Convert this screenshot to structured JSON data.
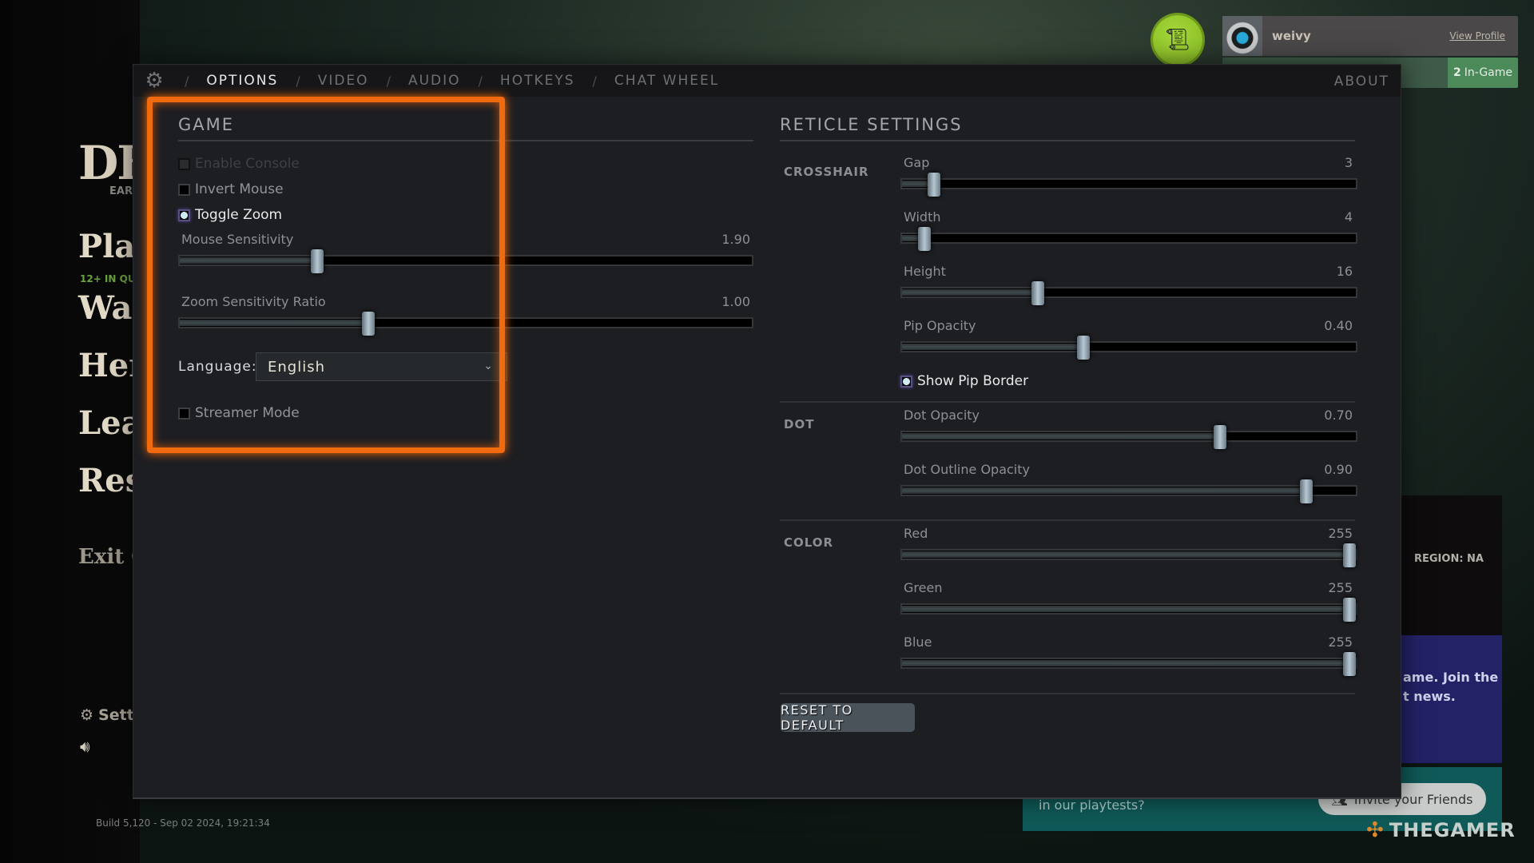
{
  "background": {
    "logo": "DE",
    "logo_sub": "EAR",
    "menu": [
      {
        "label": "Play"
      },
      {
        "label": "Wat"
      },
      {
        "label": "Her"
      },
      {
        "label": "Lear"
      },
      {
        "label": "Res"
      },
      {
        "label": "Exit G"
      }
    ],
    "queue_badge": "12+ IN QU",
    "settings_label": "Sett",
    "build": "Build 5,120 - Sep 02 2024, 19:21:34",
    "profile": {
      "name": "weivy",
      "view_profile": "View Profile"
    },
    "friends": {
      "count": "2",
      "label": "In-Game"
    },
    "region": "REGION: NA",
    "promo_text": [
      "ame. Join the",
      "t news."
    ],
    "playtest_text": "in our playtests?",
    "invite_label": "Invite your Friends",
    "watermark": "THEGAMER"
  },
  "tabs": {
    "items": [
      {
        "label": "OPTIONS",
        "active": true
      },
      {
        "label": "VIDEO",
        "active": false
      },
      {
        "label": "AUDIO",
        "active": false
      },
      {
        "label": "HOTKEYS",
        "active": false
      },
      {
        "label": "CHAT WHEEL",
        "active": false
      }
    ],
    "about": "ABOUT"
  },
  "game": {
    "title": "GAME",
    "checkboxes": [
      {
        "label": "Enable Console",
        "checked": false,
        "disabled": true
      },
      {
        "label": "Invert Mouse",
        "checked": false,
        "disabled": false
      },
      {
        "label": "Toggle Zoom",
        "checked": true,
        "disabled": false
      }
    ],
    "sliders": [
      {
        "label": "Mouse Sensitivity",
        "value": "1.90",
        "fraction": 0.24
      },
      {
        "label": "Zoom Sensitivity Ratio",
        "value": "1.00",
        "fraction": 0.33
      }
    ],
    "language": {
      "label": "Language:",
      "value": "English"
    },
    "streamer_mode": {
      "label": "Streamer Mode",
      "checked": false
    }
  },
  "reticle": {
    "title": "RETICLE SETTINGS",
    "groups": [
      {
        "label": "CROSSHAIR",
        "sliders": [
          {
            "label": "Gap",
            "value": "3",
            "fraction": 0.07
          },
          {
            "label": "Width",
            "value": "4",
            "fraction": 0.05
          },
          {
            "label": "Height",
            "value": "16",
            "fraction": 0.3
          },
          {
            "label": "Pip Opacity",
            "value": "0.40",
            "fraction": 0.4
          }
        ],
        "checkbox": {
          "label": "Show Pip Border",
          "checked": true
        }
      },
      {
        "label": "DOT",
        "sliders": [
          {
            "label": "Dot Opacity",
            "value": "0.70",
            "fraction": 0.7
          },
          {
            "label": "Dot Outline Opacity",
            "value": "0.90",
            "fraction": 0.89
          }
        ]
      },
      {
        "label": "COLOR",
        "sliders": [
          {
            "label": "Red",
            "value": "255",
            "fraction": 1.0
          },
          {
            "label": "Green",
            "value": "255",
            "fraction": 1.0
          },
          {
            "label": "Blue",
            "value": "255",
            "fraction": 1.0
          }
        ]
      }
    ],
    "reset_label": "RESET TO DEFAULT"
  },
  "colors": {
    "highlight": "#f06a10",
    "accent_green": "#86bb22",
    "friends_green": "#4c8a5a"
  }
}
